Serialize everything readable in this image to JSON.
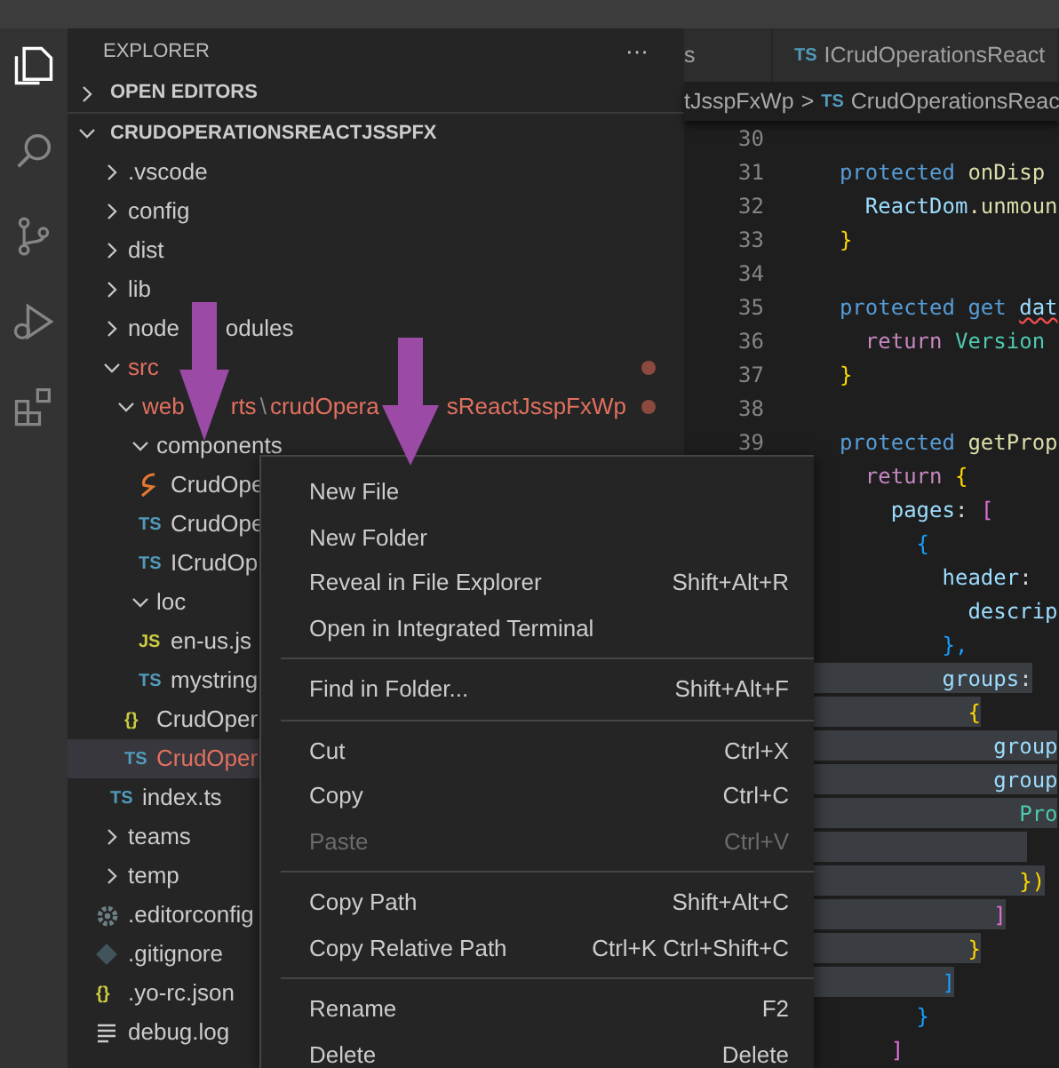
{
  "activity_bar": [
    {
      "kind": "files",
      "selected": true
    },
    {
      "kind": "search",
      "selected": false
    },
    {
      "kind": "branch",
      "selected": false
    },
    {
      "kind": "debug",
      "selected": false
    },
    {
      "kind": "extensions",
      "selected": false
    }
  ],
  "explorer": {
    "title": "EXPLORER",
    "more": "···",
    "sections": [
      {
        "label": "OPEN EDITORS",
        "expanded": false
      },
      {
        "label": "CRUDOPERATIONSREACTJSSPFX",
        "expanded": true
      }
    ],
    "tree": [
      {
        "name": ".vscode",
        "kind": "folder",
        "expanded": false
      },
      {
        "name": "config",
        "kind": "folder",
        "expanded": false
      },
      {
        "name": "dist",
        "kind": "folder",
        "expanded": false
      },
      {
        "name": "lib",
        "kind": "folder",
        "expanded": false
      },
      {
        "parts": [
          {
            "text": "node",
            "kind": "text"
          },
          {
            "text": "odules",
            "kind": "text"
          }
        ],
        "kind": "folder",
        "expanded": false
      },
      {
        "name": "src",
        "kind": "folder",
        "expanded": true,
        "modified": true,
        "children": [
          {
            "parts": [
              {
                "text": "web",
                "kind": "text"
              },
              {
                "text": "rts",
                "kind": "text"
              },
              {
                "text": "\\",
                "kind": "separator"
              },
              {
                "text": "crudOpera",
                "kind": "text"
              },
              {
                "text": "sReactJsspFxWp",
                "kind": "text"
              }
            ],
            "kind": "folder",
            "expanded": true,
            "modified": true,
            "children": [
              {
                "name": "components",
                "kind": "folder",
                "expanded": true,
                "children": [
                  {
                    "name": "CrudOpe",
                    "kind": "react"
                  },
                  {
                    "name": "CrudOpe",
                    "kind": "ts",
                    "badge": "TS"
                  },
                  {
                    "name": "ICrudOp",
                    "kind": "ts",
                    "badge": "TS"
                  }
                ]
              },
              {
                "name": "loc",
                "kind": "folder",
                "expanded": true,
                "children": [
                  {
                    "name": "en-us.js",
                    "kind": "js",
                    "badge": "JS"
                  },
                  {
                    "name": "mystring",
                    "kind": "ts",
                    "badge": "TS"
                  }
                ]
              },
              {
                "name": "CrudOper",
                "kind": "json",
                "badge": "{}"
              },
              {
                "name": "CrudOper",
                "kind": "ts",
                "badge": "TS",
                "selected": true,
                "modified": true
              }
            ]
          },
          {
            "name": "index.ts",
            "kind": "ts",
            "badge": "TS"
          }
        ]
      },
      {
        "name": "teams",
        "kind": "folder",
        "expanded": false
      },
      {
        "name": "temp",
        "kind": "folder",
        "expanded": false
      },
      {
        "name": ".editorconfig",
        "kind": "gear"
      },
      {
        "name": ".gitignore",
        "kind": "git"
      },
      {
        "name": ".yo-rc.json",
        "kind": "json",
        "badge": "{}"
      },
      {
        "name": "debug.log",
        "kind": "log"
      }
    ]
  },
  "tabs": [
    {
      "label": "s",
      "selected": false
    },
    {
      "badge": "TS",
      "label": "ICrudOperationsReact",
      "selected": false
    }
  ],
  "breadcrumbs": {
    "folder": "tJsspFxWp",
    "separator": ">",
    "badge": "TS",
    "file": "CrudOperationsReac"
  },
  "code_lines": [
    {
      "number": "30"
    },
    {
      "number": "31",
      "tokens": [
        {
          "text": "  protected",
          "kind": "keyword"
        },
        {
          "text": " onDisp",
          "kind": "function"
        }
      ]
    },
    {
      "number": "32",
      "tokens": [
        {
          "text": "    ReactDom",
          "kind": "variable"
        },
        {
          "text": ".unmoun",
          "kind": "function"
        }
      ]
    },
    {
      "number": "33",
      "tokens": [
        {
          "text": "  }",
          "kind": "bracket"
        }
      ]
    },
    {
      "number": "34"
    },
    {
      "number": "35",
      "tokens": [
        {
          "text": "  protected get ",
          "kind": "keyword"
        },
        {
          "text": "dat",
          "kind": "error"
        }
      ]
    },
    {
      "number": "36",
      "tokens": [
        {
          "text": "    return",
          "kind": "control"
        },
        {
          "text": " Version",
          "kind": "type"
        }
      ]
    },
    {
      "number": "37",
      "tokens": [
        {
          "text": "  }",
          "kind": "bracket"
        }
      ]
    },
    {
      "number": "38"
    },
    {
      "number": "39",
      "tokens": [
        {
          "text": "  protected",
          "kind": "keyword"
        },
        {
          "text": " getProp",
          "kind": "function"
        }
      ]
    },
    {
      "tokens": [
        {
          "text": "    return",
          "kind": "control"
        },
        {
          "text": " {",
          "kind": "bracket"
        }
      ]
    },
    {
      "tokens": [
        {
          "text": "      pages",
          "kind": "variable"
        },
        {
          "text": ": ",
          "kind": "plain"
        },
        {
          "text": "[",
          "kind": "bracket2"
        }
      ]
    },
    {
      "tokens": [
        {
          "text": "        {",
          "kind": "bracket3"
        }
      ]
    },
    {
      "tokens": [
        {
          "text": "          header",
          "kind": "variable"
        },
        {
          "text": ":",
          "kind": "plain"
        }
      ]
    },
    {
      "tokens": [
        {
          "text": "            descrip",
          "kind": "variable"
        }
      ]
    },
    {
      "tokens": [
        {
          "text": "          },",
          "kind": "bracket3"
        }
      ]
    },
    {
      "highlighted": true,
      "tokens": [
        {
          "text": "          groups",
          "kind": "variable"
        },
        {
          "text": ":",
          "kind": "plain"
        }
      ]
    },
    {
      "highlighted": true,
      "tokens": [
        {
          "text": "            {",
          "kind": "bracket"
        }
      ]
    },
    {
      "highlighted": true,
      "tokens": [
        {
          "text": "              group",
          "kind": "variable"
        }
      ]
    },
    {
      "highlighted": true,
      "tokens": [
        {
          "text": "              group",
          "kind": "variable"
        }
      ]
    },
    {
      "highlighted": true,
      "tokens": [
        {
          "text": "                Pro",
          "kind": "type"
        }
      ]
    },
    {
      "highlighted": true
    },
    {
      "highlighted": true,
      "tokens": [
        {
          "text": "                })",
          "kind": "bracket"
        }
      ]
    },
    {
      "highlighted": true,
      "tokens": [
        {
          "text": "              ]",
          "kind": "bracket2"
        }
      ]
    },
    {
      "highlighted": true,
      "tokens": [
        {
          "text": "            }",
          "kind": "bracket"
        }
      ]
    },
    {
      "highlighted": true,
      "tokens": [
        {
          "text": "          ]",
          "kind": "bracket3"
        }
      ]
    },
    {
      "tokens": [
        {
          "text": "        }",
          "kind": "bracket3"
        }
      ]
    },
    {
      "tokens": [
        {
          "text": "      ]",
          "kind": "bracket2"
        }
      ]
    }
  ],
  "context_menu": {
    "groups": [
      [
        {
          "label": "New File",
          "disabled": false
        },
        {
          "label": "New Folder",
          "disabled": false
        },
        {
          "label": "Reveal in File Explorer",
          "shortcut": "Shift+Alt+R",
          "disabled": false
        },
        {
          "label": "Open in Integrated Terminal",
          "disabled": false
        }
      ],
      [
        {
          "label": "Find in Folder...",
          "shortcut": "Shift+Alt+F",
          "disabled": false
        }
      ],
      [
        {
          "label": "Cut",
          "shortcut": "Ctrl+X",
          "disabled": false
        },
        {
          "label": "Copy",
          "shortcut": "Ctrl+C",
          "disabled": false
        },
        {
          "label": "Paste",
          "shortcut": "Ctrl+V",
          "disabled": true
        }
      ],
      [
        {
          "label": "Copy Path",
          "shortcut": "Shift+Alt+C",
          "disabled": false
        },
        {
          "label": "Copy Relative Path",
          "shortcut": "Ctrl+K Ctrl+Shift+C",
          "disabled": false
        }
      ],
      [
        {
          "label": "Rename",
          "shortcut": "F2",
          "disabled": false
        },
        {
          "label": "Delete",
          "shortcut": "Delete",
          "disabled": false
        }
      ]
    ]
  },
  "annotations": [
    {
      "kind": "arrow"
    },
    {
      "kind": "arrow"
    }
  ]
}
